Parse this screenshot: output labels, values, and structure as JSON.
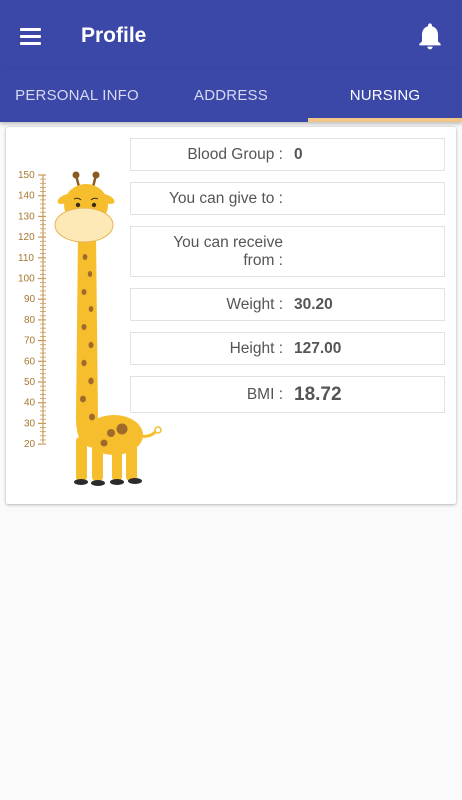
{
  "app": {
    "title": "Profile"
  },
  "icons": {
    "menu": "menu-icon",
    "notification": "bell-icon"
  },
  "tabs": [
    {
      "label": "PERSONAL INFO",
      "active": false
    },
    {
      "label": "ADDRESS",
      "active": false
    },
    {
      "label": "NURSING",
      "active": true
    }
  ],
  "height_chart": {
    "ticks": [
      "150",
      "140",
      "130",
      "120",
      "110",
      "100",
      "90",
      "80",
      "70",
      "60",
      "50",
      "40",
      "30",
      "20"
    ]
  },
  "nursing": {
    "blood_group": {
      "label": "Blood Group :",
      "value": "0"
    },
    "can_give_to": {
      "label": "You can give to :",
      "value": ""
    },
    "can_receive_from": {
      "label_line1": "You can receive",
      "label_line2": "from :",
      "value": ""
    },
    "weight": {
      "label": "Weight :",
      "value": "30.20"
    },
    "height": {
      "label": "Height :",
      "value": "127.00"
    },
    "bmi": {
      "label": "BMI :",
      "value": "18.72"
    }
  },
  "colors": {
    "primary": "#3b48a8",
    "tab_indicator": "#f2c689",
    "giraffe_body": "#f6be2c",
    "giraffe_spots": "#a06a2c"
  }
}
